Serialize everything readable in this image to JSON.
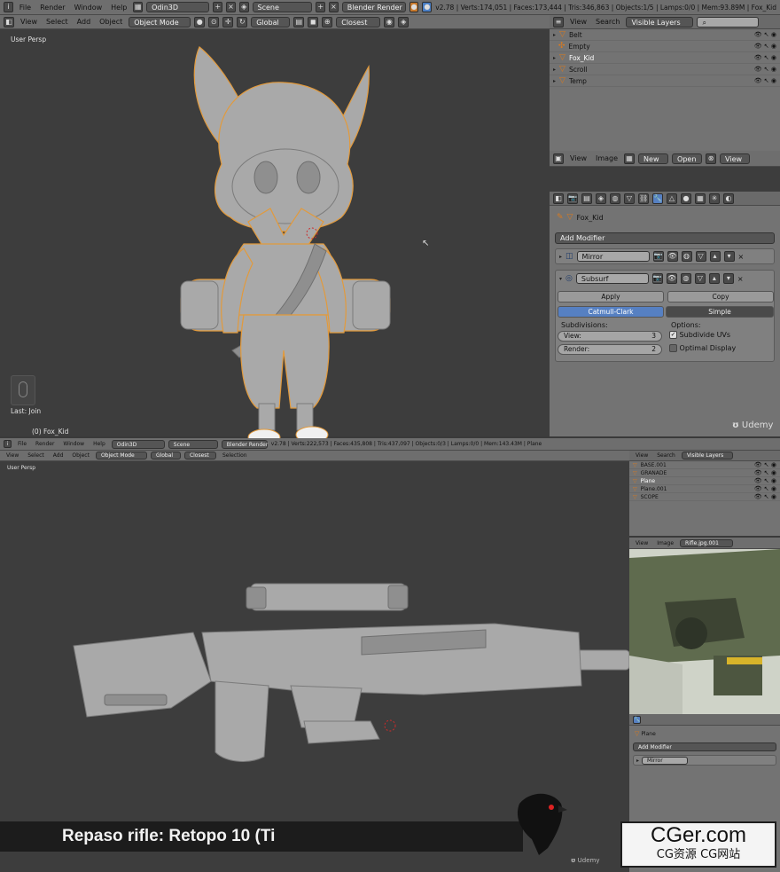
{
  "top": {
    "header": {
      "menus": [
        "File",
        "Render",
        "Window",
        "Help"
      ],
      "layout": "Odin3D",
      "scene": "Scene",
      "engine": "Blender Render",
      "stats": "v2.78 | Verts:174,051 | Faces:173,444 | Tris:346,863 | Objects:1/5 | Lamps:0/0 | Mem:93.89M | Fox_Kid"
    },
    "view_header": {
      "menus": [
        "View",
        "Select",
        "Add",
        "Object"
      ],
      "mode": "Object Mode",
      "orientation": "Global",
      "snap": "Closest"
    },
    "viewport": {
      "label": "User Persp",
      "last_op": "Last: Join",
      "object": "(0) Fox_Kid",
      "brand": "Udemy"
    },
    "outliner": {
      "menus": [
        "View",
        "Search"
      ],
      "display": "Visible Layers",
      "items": [
        "Belt",
        "Empty",
        "Fox_Kid",
        "Scroll",
        "Temp"
      ]
    },
    "image_editor": {
      "menus": [
        "View",
        "Image"
      ],
      "new_label": "New",
      "open_label": "Open",
      "view_label": "View"
    },
    "properties": {
      "object": "Fox_Kid",
      "add_modifier": "Add Modifier",
      "mirror": "Mirror",
      "subsurf": "Subsurf",
      "apply": "Apply",
      "copy": "Copy",
      "catmull": "Catmull-Clark",
      "simple": "Simple",
      "subdivisions_label": "Subdivisions:",
      "view_label": "View:",
      "view_value": "3",
      "render_label": "Render:",
      "render_value": "2",
      "options_label": "Options:",
      "subdivide_uvs": "Subdivide UVs",
      "optimal_display": "Optimal Display"
    }
  },
  "bottom": {
    "header": {
      "menus": [
        "File",
        "Render",
        "Window",
        "Help"
      ],
      "layout": "Odin3D",
      "scene": "Scene",
      "engine": "Blender Render",
      "stats": "v2.78 | Verts:222,573 | Faces:435,808 | Tris:437,097 | Objects:0/3 | Lamps:0/0 | Mem:143.43M | Plane"
    },
    "view_header": {
      "menus": [
        "View",
        "Select",
        "Add",
        "Object"
      ],
      "mode": "Object Mode",
      "orientation": "Global",
      "snap": "Closest",
      "selection": "Selection"
    },
    "viewport": {
      "label": "User Persp",
      "banner": "Repaso rifle: Retopo 10 (Ti",
      "brand": "Udemy"
    },
    "outliner": {
      "menus": [
        "View",
        "Search"
      ],
      "display": "Visible Layers",
      "items": [
        "BASE.001",
        "GRANADE",
        "Plane",
        "Plane.001",
        "SCOPE"
      ]
    },
    "image_editor": {
      "menus": [
        "View",
        "Image"
      ],
      "image": "Rifle.jpg.001"
    },
    "properties": {
      "object": "Plane",
      "add_modifier": "Add Modifier",
      "mirror": "Mirror"
    }
  },
  "watermark": {
    "title": "CGer.com",
    "subtitle": "CG资源 CG网站"
  }
}
